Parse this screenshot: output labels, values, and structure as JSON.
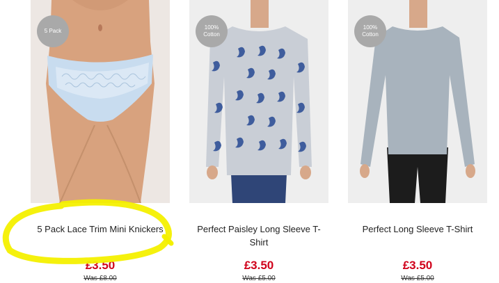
{
  "products": [
    {
      "badge": "5 Pack",
      "title": "5 Pack Lace Trim Mini Knickers",
      "price": "£3.50",
      "was": "Was £8.00",
      "image": "knickers-photo"
    },
    {
      "badge": "100%\nCotton",
      "title": "Perfect Paisley Long Sleeve T-Shirt",
      "price": "£3.50",
      "was": "Was £5.00",
      "image": "paisley-tshirt-photo"
    },
    {
      "badge": "100%\nCotton",
      "title": "Perfect Long Sleeve T-Shirt",
      "price": "£3.50",
      "was": "Was £5.00",
      "image": "grey-tshirt-photo"
    }
  ],
  "colors": {
    "price": "#d0021b",
    "badge": "#a9a9a9",
    "highlight": "#f4f000"
  }
}
